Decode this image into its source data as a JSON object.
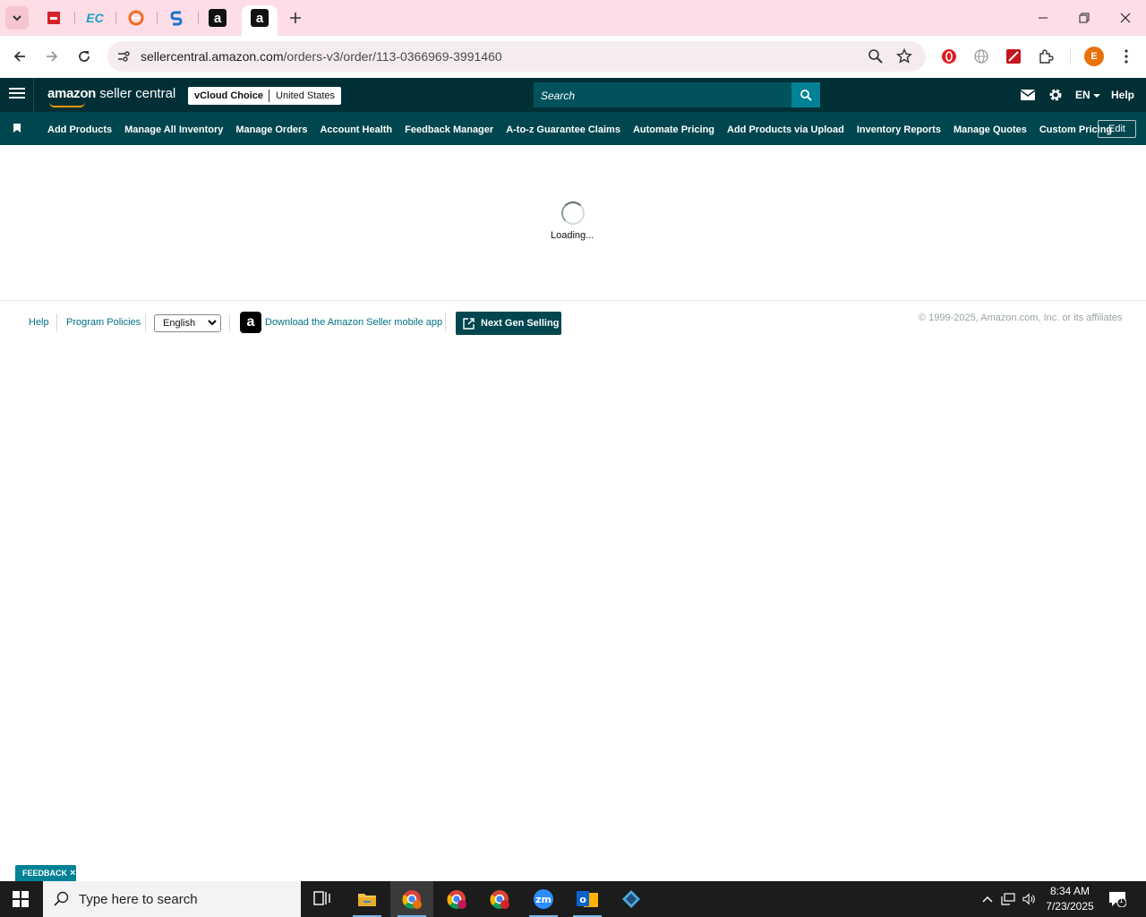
{
  "browser": {
    "tabs": [
      {
        "name": "tab-1",
        "icon": "red-brand-icon"
      },
      {
        "name": "tab-2",
        "icon": "ec-icon",
        "glyph": "EC"
      },
      {
        "name": "tab-3",
        "icon": "orange-s-icon"
      },
      {
        "name": "tab-4",
        "icon": "blue-s-icon"
      },
      {
        "name": "tab-5",
        "icon": "amazon-a-icon",
        "glyph": "a"
      },
      {
        "name": "tab-6",
        "icon": "amazon-a-icon",
        "glyph": "a",
        "active": true
      }
    ],
    "url_host": "sellercentral.amazon.com",
    "url_path": "/orders-v3/order/113-0366969-3991460",
    "profile_initial": "E"
  },
  "header": {
    "logo_bold": "amazon",
    "logo_rest": " seller central",
    "store": "vCloud Choice",
    "marketplace": "United States",
    "search_placeholder": "Search",
    "lang": "EN",
    "help": "Help"
  },
  "nav": {
    "links": [
      "Add Products",
      "Manage All Inventory",
      "Manage Orders",
      "Account Health",
      "Feedback Manager",
      "A-to-z Guarantee Claims",
      "Automate Pricing",
      "Add Products via Upload",
      "Inventory Reports",
      "Manage Quotes",
      "Custom Pricing"
    ],
    "edit": "Edit"
  },
  "main": {
    "loading_text": "Loading..."
  },
  "footer": {
    "help": "Help",
    "program_policies": "Program Policies",
    "language": "English",
    "download_app": "Download the Amazon Seller mobile app",
    "next_gen": "Next Gen Selling",
    "copyright": "© 1999-2025, Amazon.com, Inc. or its affiliates"
  },
  "feedback": {
    "label": "FEEDBACK",
    "close": "×"
  },
  "taskbar": {
    "search_placeholder": "Type here to search",
    "time": "8:34 AM",
    "date": "7/23/2025",
    "notification_count": "1"
  },
  "colors": {
    "header_bg": "#002f36",
    "nav_bg": "#00464f",
    "accent_teal": "#008296",
    "link": "#007185",
    "tabstrip_bg": "#fddde6"
  }
}
